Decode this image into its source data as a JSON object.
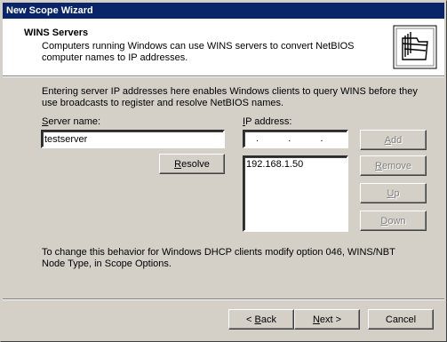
{
  "window": {
    "title": "New Scope Wizard"
  },
  "header": {
    "title": "WINS Servers",
    "subtitle": "Computers running Windows can use WINS servers to convert NetBIOS computer names to IP addresses.",
    "icon": "folders-icon"
  },
  "intro": "Entering server IP addresses here enables Windows clients to query WINS before they use broadcasts to register and resolve NetBIOS names.",
  "server_name": {
    "label_pre": "",
    "label_accel": "S",
    "label_post": "erver name:",
    "value": "testserver"
  },
  "ip_address": {
    "label_pre": "",
    "label_accel": "I",
    "label_post": "P address:",
    "value": " .   .   . "
  },
  "resolve_button": {
    "label_pre": "",
    "label_accel": "R",
    "label_post": "esolve"
  },
  "ip_list": [
    "192.168.1.50"
  ],
  "side_buttons": {
    "add": {
      "label_pre": "",
      "label_accel": "A",
      "label_post": "dd"
    },
    "remove": {
      "label_pre": "",
      "label_accel": "R",
      "label_post": "emove"
    },
    "up": {
      "label_pre": "",
      "label_accel": "U",
      "label_post": "p"
    },
    "down": {
      "label_pre": "",
      "label_accel": "D",
      "label_post": "own"
    }
  },
  "footer_note": "To change this behavior for Windows DHCP clients modify option 046, WINS/NBT Node Type, in Scope Options.",
  "nav": {
    "back": {
      "prefix": "< ",
      "accel": "B",
      "suffix": "ack"
    },
    "next": {
      "prefix": "",
      "accel": "N",
      "suffix": "ext >"
    },
    "cancel": "Cancel"
  }
}
